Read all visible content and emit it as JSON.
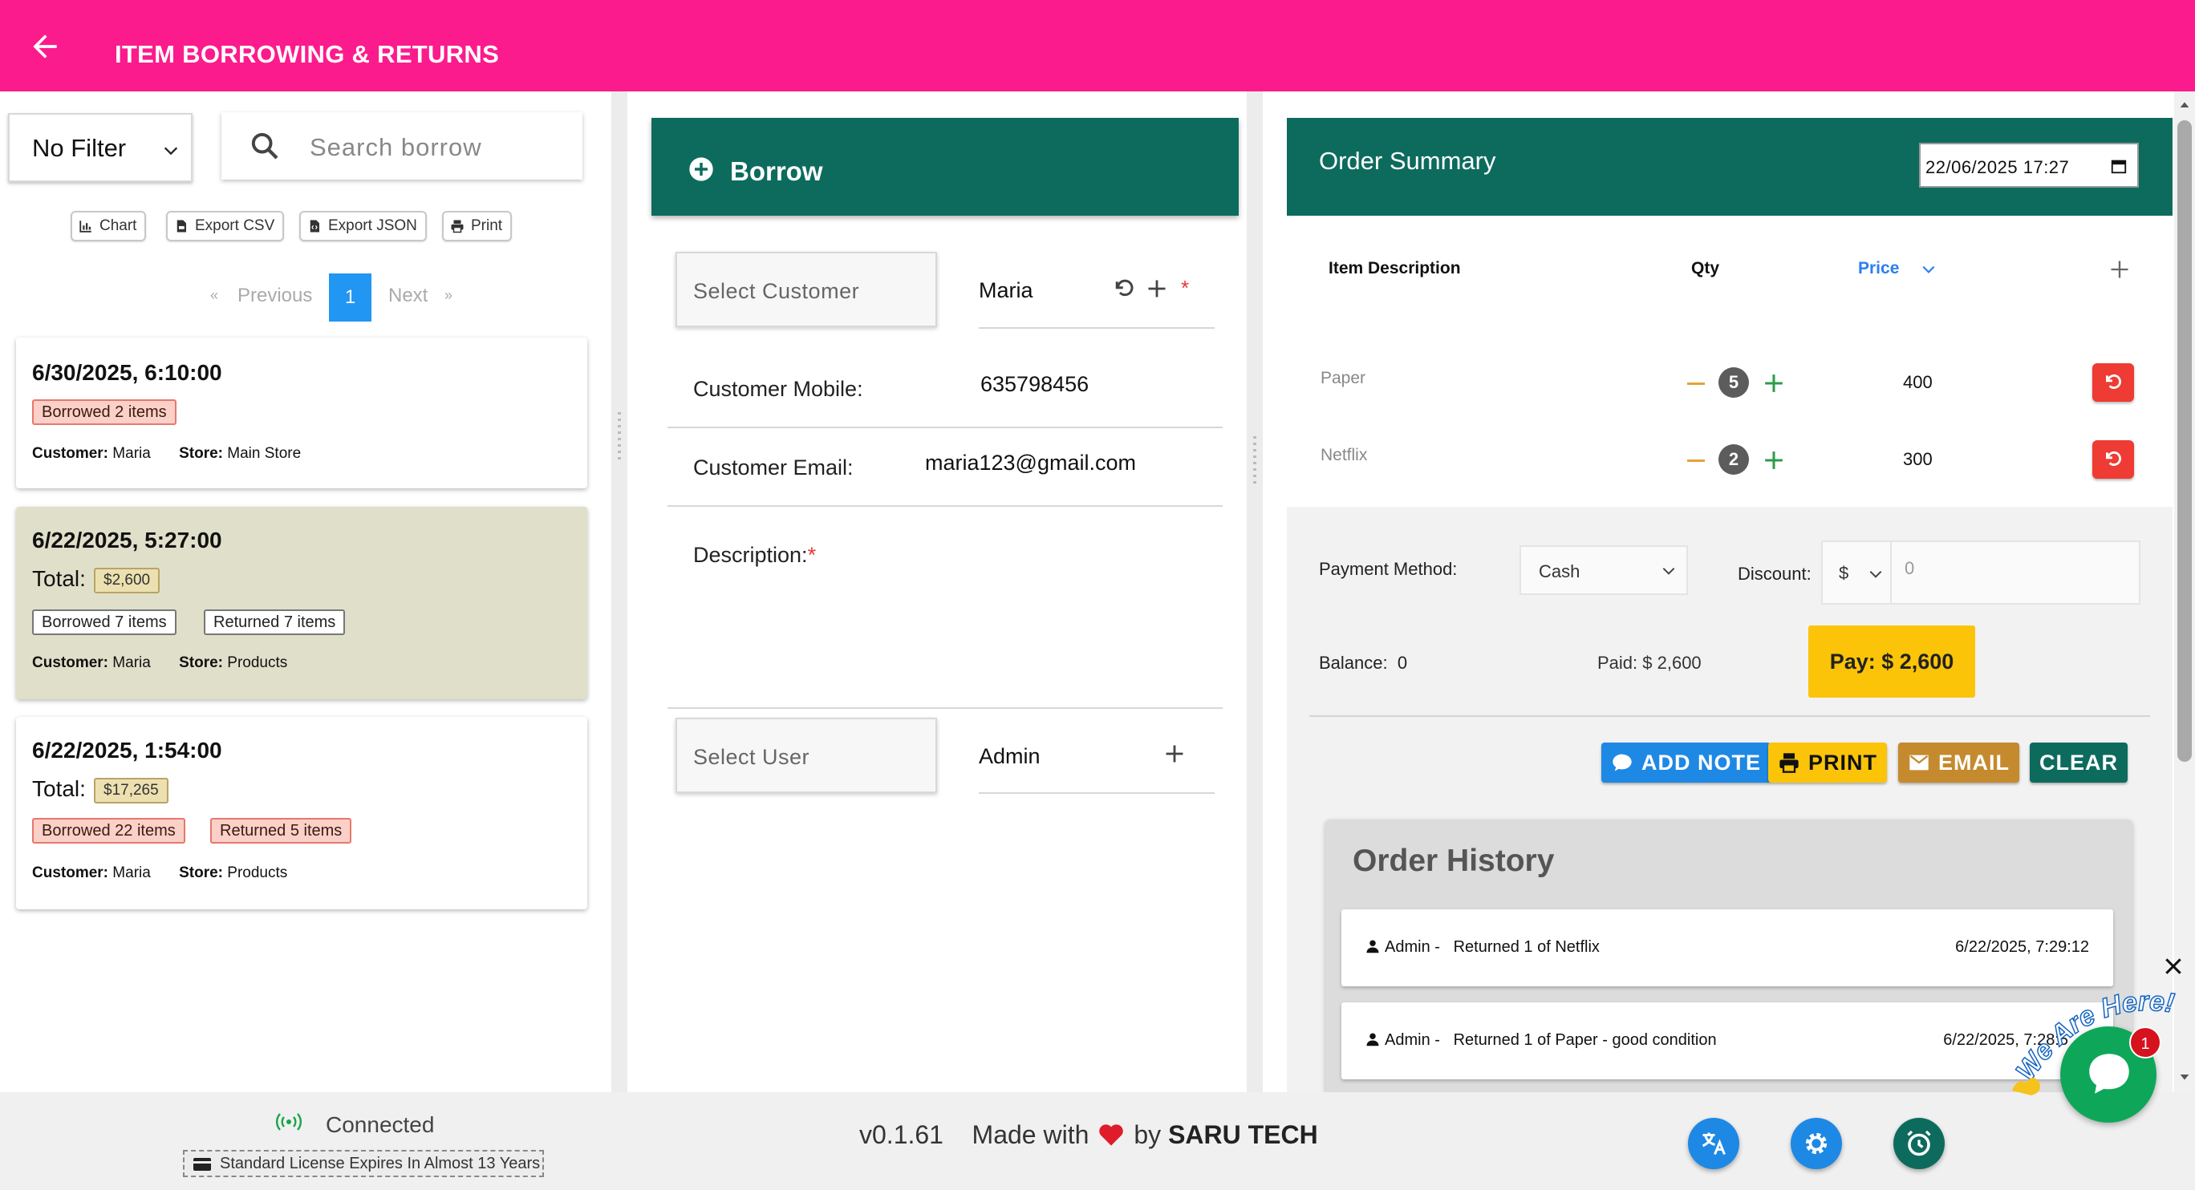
{
  "header": {
    "title": "ITEM BORROWING & RETURNS"
  },
  "left": {
    "filter": "No Filter",
    "search_placeholder": "Search  borrow",
    "tools": [
      "Chart",
      "Export CSV",
      "Export JSON",
      "Print"
    ],
    "pager": {
      "prev": "Previous",
      "page": "1",
      "next": "Next",
      "prev_arrow": "«",
      "next_arrow": "»"
    },
    "cards": [
      {
        "date": "6/30/2025, 6:10:00",
        "badges": [
          "Borrowed 2 items"
        ],
        "customer_label": "Customer:",
        "customer": "Maria",
        "store_label": "Store:",
        "store": "Main Store"
      },
      {
        "date": "6/22/2025, 5:27:00",
        "total_label": "Total:",
        "total": "$2,600",
        "badges": [
          "Borrowed 7 items",
          "Returned 7 items"
        ],
        "customer_label": "Customer:",
        "customer": "Maria",
        "store_label": "Store:",
        "store": "Products"
      },
      {
        "date": "6/22/2025, 1:54:00",
        "total_label": "Total:",
        "total": "$17,265",
        "badges": [
          "Borrowed 22 items",
          "Returned 5 items"
        ],
        "customer_label": "Customer:",
        "customer": "Maria",
        "store_label": "Store:",
        "store": "Products"
      }
    ]
  },
  "middle": {
    "title": "Borrow",
    "select_customer": "Select  Customer",
    "customer_name": "Maria",
    "required_mark": "*",
    "mobile_label": "Customer Mobile:",
    "mobile": "635798456",
    "email_label": "Customer Email:",
    "email": "maria123@gmail.com",
    "description_label": "Description:",
    "select_user": "Select  User",
    "user_name": "Admin"
  },
  "order": {
    "title": "Order Summary",
    "datetime": "22/06/2025 17:27",
    "col_item": "Item Description",
    "col_qty": "Qty",
    "col_price": "Price",
    "items": [
      {
        "name": "Paper",
        "qty": "5",
        "price": "400"
      },
      {
        "name": "Netflix",
        "qty": "2",
        "price": "300"
      }
    ],
    "payment_label": "Payment Method:",
    "payment_method": "Cash",
    "discount_label": "Discount:",
    "discount_unit": "$",
    "discount_value": "0",
    "balance_label": "Balance:",
    "balance": "0",
    "paid": "Paid: $ 2,600",
    "pay_button": "Pay: $ 2,600",
    "actions": [
      "ADD NOTE",
      "PRINT",
      "EMAIL",
      "CLEAR"
    ],
    "history_title": "Order History",
    "history": [
      {
        "user": "Admin -",
        "text": "Returned 1 of Netflix",
        "date": "6/22/2025, 7:29:12"
      },
      {
        "user": "Admin -",
        "text": "Returned 1 of Paper - good condition",
        "date": "6/22/2025, 7:28:5"
      }
    ]
  },
  "footer": {
    "status": "Connected",
    "license": "Standard License Expires In Almost 13 Years",
    "version": "v0.1.61",
    "made_with": "Made with",
    "by": "by",
    "brand": "SARU TECH"
  },
  "chat": {
    "label": "We Are Here!",
    "badge": "1"
  },
  "colors": {
    "header": "#fc1b8c",
    "teal": "#0d6b5e",
    "pay": "#fbc408",
    "note": "#1e88e5",
    "email": "#c58a2e",
    "clear": "#0d6b5e"
  }
}
